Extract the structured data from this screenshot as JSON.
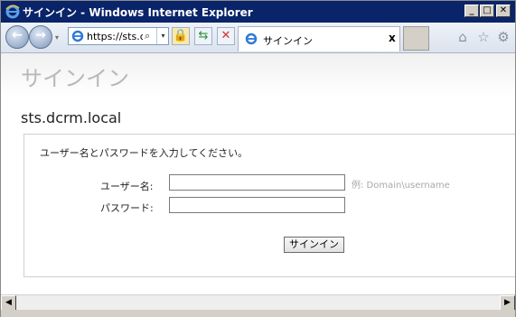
{
  "window": {
    "title": "サインイン - Windows Internet Explorer",
    "minimize": "_",
    "maximize": "□",
    "close": "✕"
  },
  "toolbar": {
    "back_icon": "←",
    "forward_icon": "→",
    "address_value": "https://sts.c",
    "search_icon": "⌕",
    "dropdown_icon": "▾",
    "lock_icon": "🔒",
    "refresh_icon": "⇆",
    "stop_icon": "✕",
    "home_icon": "⌂",
    "favorites_icon": "☆",
    "tools_icon": "⚙"
  },
  "tab": {
    "label": "サインイン",
    "close": "x"
  },
  "page": {
    "heading": "サインイン",
    "site": "sts.dcrm.local",
    "instruction": "ユーザー名とパスワードを入力してください。",
    "username_label": "ユーザー名:",
    "username_value": "",
    "username_example": "例: Domain\\username",
    "password_label": "パスワード:",
    "password_value": "",
    "submit_label": "サインイン"
  },
  "scrollbar": {
    "left": "◀",
    "right": "▶"
  },
  "colors": {
    "titlebar": "#0a246a",
    "heading_gray": "#b8b8b8",
    "panel_border": "#cfcfcf"
  }
}
